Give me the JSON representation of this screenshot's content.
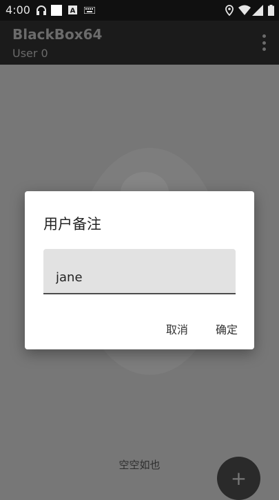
{
  "status_bar": {
    "time": "4:00",
    "icons": [
      "headphones-icon",
      "white-square-icon",
      "a-box-icon",
      "keyboard-icon",
      "location-icon",
      "wifi-icon",
      "signal-icon",
      "battery-icon"
    ]
  },
  "app_bar": {
    "title": "BlackBox64",
    "subtitle": "User 0",
    "menu_icon": "overflow-menu-icon"
  },
  "main": {
    "empty_text": "空空如也",
    "fab_label": "+"
  },
  "dialog": {
    "title": "用户备注",
    "input_value": "jane",
    "cancel_label": "取消",
    "ok_label": "确定"
  },
  "colors": {
    "status_bar": "#101010",
    "app_bar": "#1b1b1b",
    "scrim": "#777777",
    "dialog": "#ffffff",
    "input_bg": "#e2e2e2"
  }
}
